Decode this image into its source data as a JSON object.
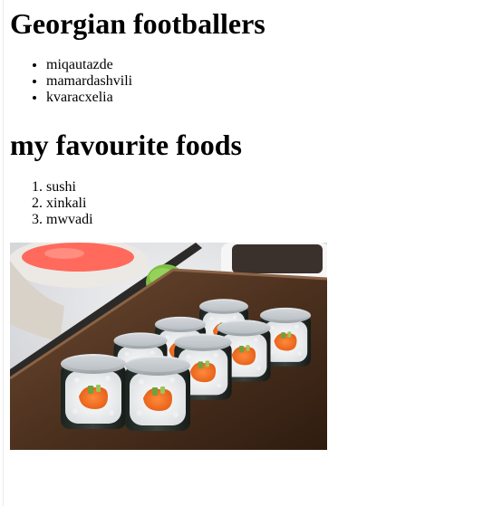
{
  "sections": [
    {
      "heading": "Georgian footballers",
      "items": [
        "miqautazde",
        "mamardashvili",
        "kvaracxelia"
      ]
    },
    {
      "heading": "my favourite foods",
      "items": [
        "sushi",
        "xinkali",
        "mwvadi"
      ]
    }
  ],
  "image": {
    "subject": "sushi rolls with salmon and cucumber on a wooden board"
  }
}
